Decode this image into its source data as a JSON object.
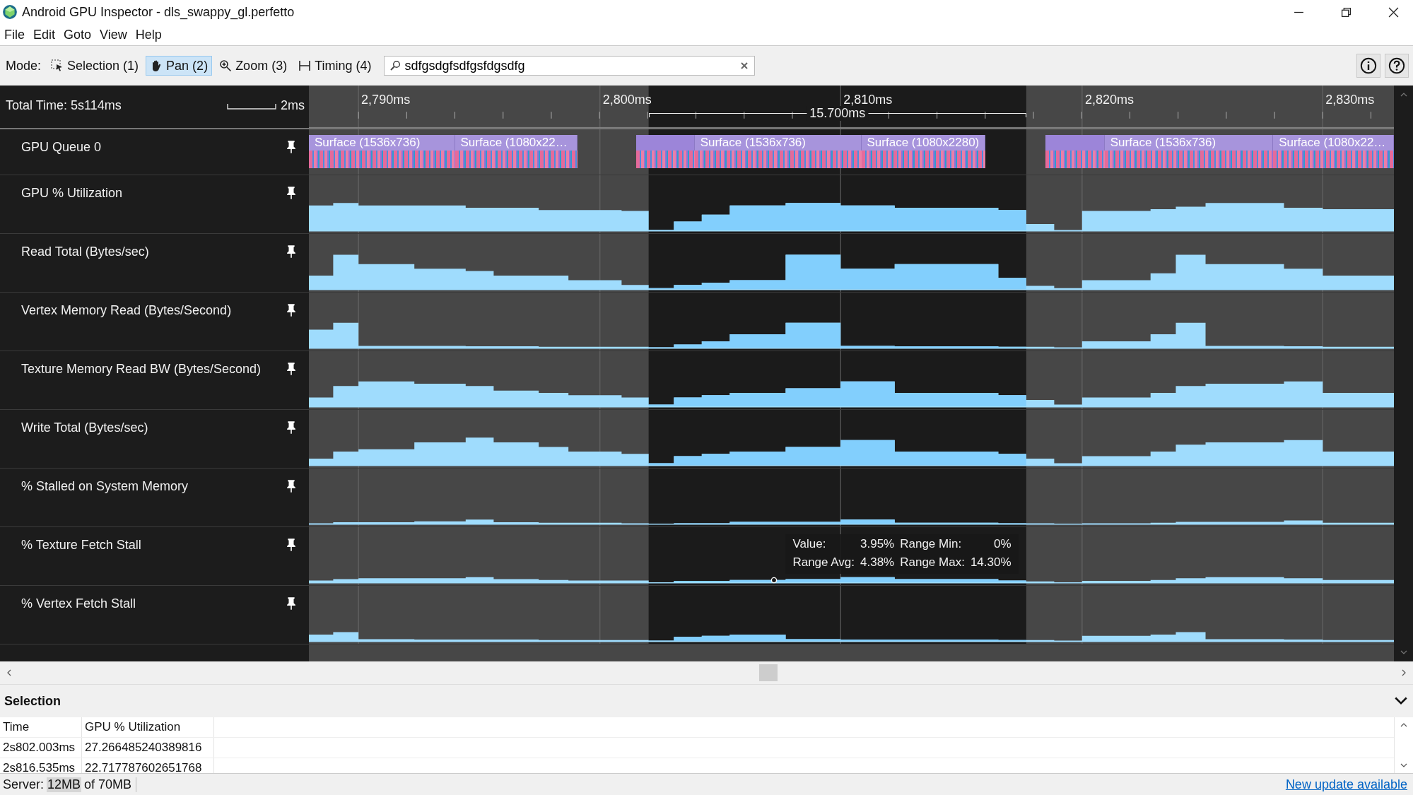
{
  "window": {
    "title": "Android GPU Inspector - dls_swappy_gl.perfetto"
  },
  "menu": [
    "File",
    "Edit",
    "Goto",
    "View",
    "Help"
  ],
  "toolbar": {
    "mode_label": "Mode:",
    "modes": [
      {
        "kind": "selection",
        "label": "Selection (1)",
        "selected": false
      },
      {
        "kind": "pan",
        "label": "Pan (2)",
        "selected": true
      },
      {
        "kind": "zoom",
        "label": "Zoom (3)",
        "selected": false
      },
      {
        "kind": "timing",
        "label": "Timing (4)",
        "selected": false
      }
    ],
    "search": {
      "value": "sdfgsdgfsdfgsfdgsdfg"
    }
  },
  "timeline": {
    "total_time": "Total Time: 5s114ms",
    "scale_label": "2ms",
    "ticks": [
      "2,790ms",
      "2,800ms",
      "2,810ms",
      "2,820ms",
      "2,830ms"
    ],
    "selection_length": "15.700ms",
    "gpu_queue": {
      "name": "GPU Queue 0",
      "slices": [
        "Surface (1536x736)",
        "Surface (1080x22…",
        "Surface (1536x736)",
        "Surface (1080x2280)",
        "Surface (1536x736)",
        "Surface (1080x22…"
      ]
    },
    "tracks": [
      "GPU % Utilization",
      "Read Total (Bytes/sec)",
      "Vertex Memory Read (Bytes/Second)",
      "Texture Memory Read BW (Bytes/Second)",
      "Write Total (Bytes/sec)",
      "% Stalled on System Memory",
      "% Texture Fetch Stall",
      "% Vertex Fetch Stall"
    ],
    "tooltip": {
      "value_label": "Value:",
      "value": "3.95%",
      "min_label": "Range Min:",
      "min": "0%",
      "avg_label": "Range Avg:",
      "avg": "4.38%",
      "max_label": "Range Max:",
      "max": "14.30%"
    }
  },
  "selection_panel": {
    "title": "Selection",
    "columns": [
      "Time",
      "GPU % Utilization"
    ],
    "rows": [
      [
        "2s802.003ms",
        "27.266485240389816"
      ],
      [
        "2s816.535ms",
        "22.717787602651768"
      ]
    ]
  },
  "status_bar": {
    "server_label": "Server:",
    "used": "12MB",
    "total": "of 70MB",
    "update_link": "New update available"
  }
}
